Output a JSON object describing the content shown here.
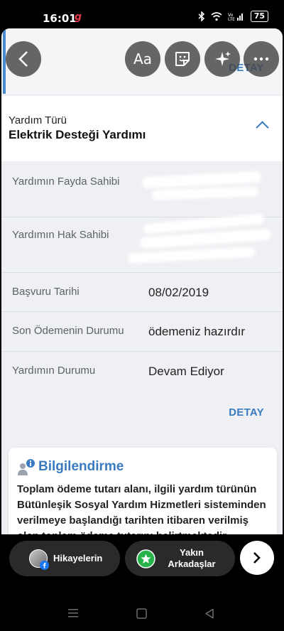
{
  "status_bar": {
    "time": "16:01",
    "app_glyph": "g",
    "battery": "75"
  },
  "top_card": {
    "detay_label": "DETAY"
  },
  "section": {
    "label": "Yardım Türü",
    "value": "Elektrik Desteği Yardımı"
  },
  "rows": [
    {
      "label": "Yardımın Fayda Sahibi",
      "value": ""
    },
    {
      "label": "Yardımın Hak Sahibi",
      "value": ""
    },
    {
      "label": "Başvuru Tarihi",
      "value": "08/02/2019"
    },
    {
      "label": "Son Ödemenin Durumu",
      "value": "ödemeniz hazırdır"
    },
    {
      "label": "Yardımın Durumu",
      "value": "Devam Ediyor"
    }
  ],
  "detay_bottom_label": "DETAY",
  "info": {
    "title": "Bilgilendirme",
    "text": "Toplam ödeme tutarı alanı, ilgili yardım türünün Bütünleşik Sosyal Yardım Hizmetleri sisteminden verilmeye başlandığı tarihten itibaren verilmiş olan toplam ödeme tutarını belirtmektedir."
  },
  "story_tools": {
    "text_tool": "Aa"
  },
  "share": {
    "stories_label": "Hikayelerin",
    "close_friends_label": "Yakın Arkadaşlar"
  },
  "colors": {
    "accent": "#3a7bc0",
    "left_bar": "#4a8bd0",
    "close_friends_green": "#27b24a"
  }
}
